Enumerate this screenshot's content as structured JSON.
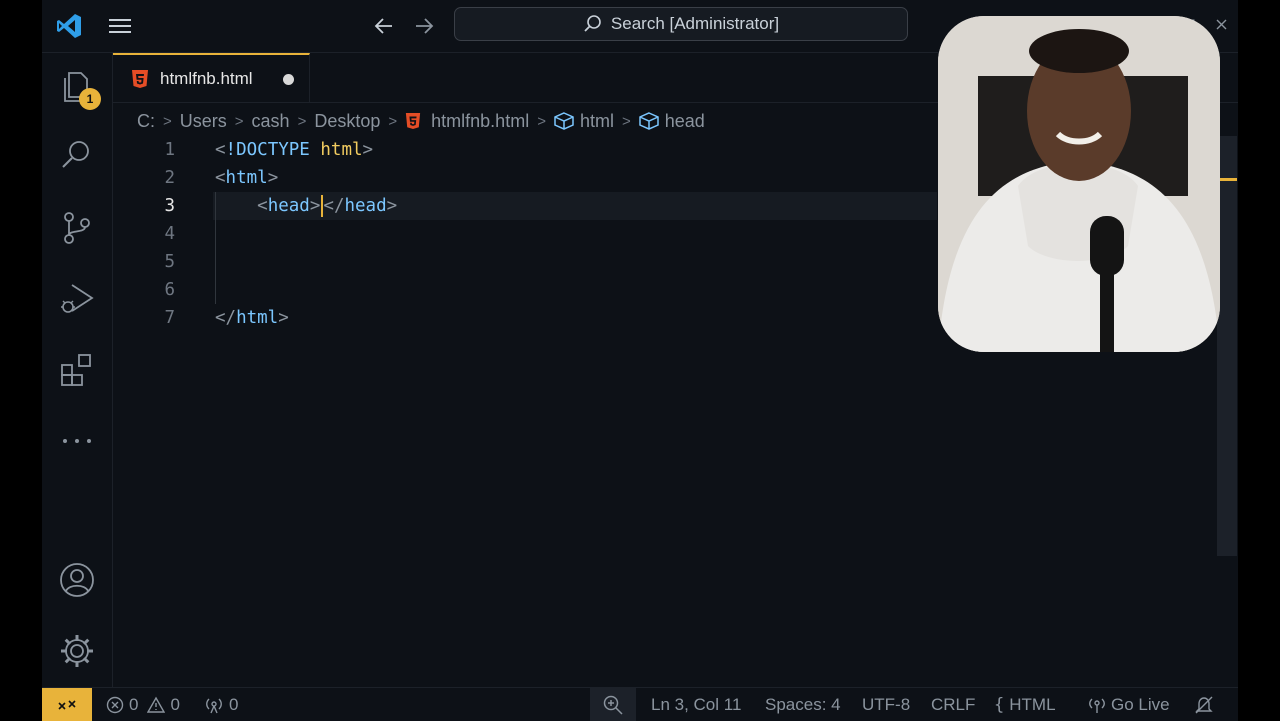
{
  "titlebar": {
    "search_placeholder": "Search [Administrator]"
  },
  "activity": {
    "explorer_badge": "1"
  },
  "tab": {
    "label": "htmlfnb.html"
  },
  "breadcrumb": {
    "items": [
      "C:",
      "Users",
      "cash",
      "Desktop",
      "htmlfnb.html",
      "html",
      "head"
    ]
  },
  "editor": {
    "line_numbers": [
      "1",
      "2",
      "3",
      "4",
      "5",
      "6",
      "7"
    ],
    "active_line": 3
  },
  "status": {
    "errors": "0",
    "warnings": "0",
    "ports": "0",
    "position": "Ln 3, Col 11",
    "spaces": "Spaces: 4",
    "encoding": "UTF-8",
    "eol": "CRLF",
    "language": "HTML",
    "golive": "Go Live"
  },
  "colors": {
    "accent": "#e8b33a",
    "background": "#0d1117",
    "tag": "#7cc7ff",
    "punctuation": "#8b949e",
    "keyword": "#f2cc60"
  }
}
